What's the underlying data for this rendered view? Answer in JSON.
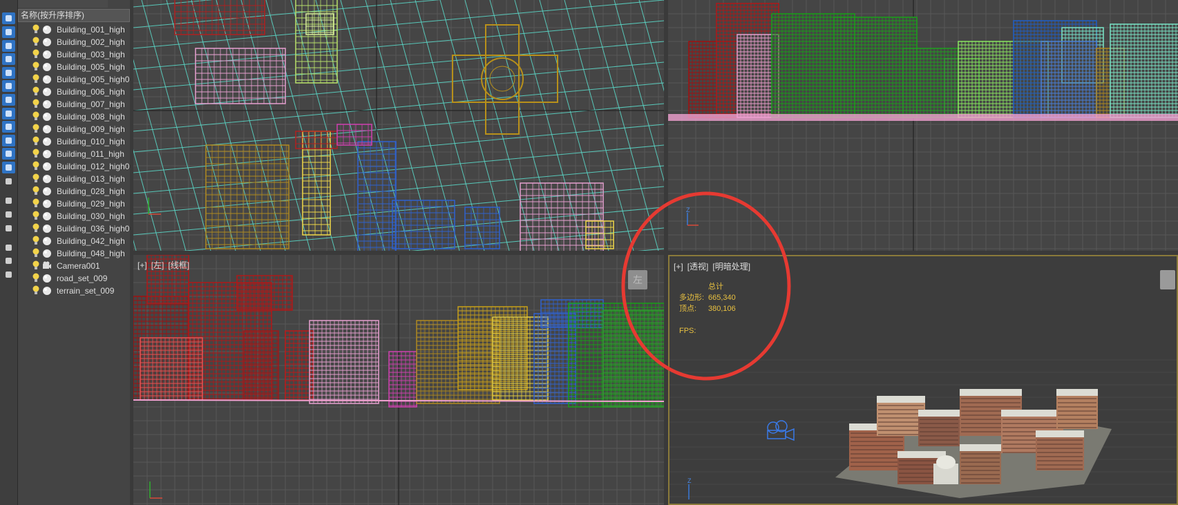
{
  "explorer": {
    "header": "名称(按升序排序)",
    "items": [
      {
        "label": "Building_001_high",
        "type": "geometry"
      },
      {
        "label": "Building_002_high",
        "type": "geometry"
      },
      {
        "label": "Building_003_high",
        "type": "geometry"
      },
      {
        "label": "Building_005_high",
        "type": "geometry"
      },
      {
        "label": "Building_005_high0",
        "type": "geometry"
      },
      {
        "label": "Building_006_high",
        "type": "geometry"
      },
      {
        "label": "Building_007_high",
        "type": "geometry"
      },
      {
        "label": "Building_008_high",
        "type": "geometry"
      },
      {
        "label": "Building_009_high",
        "type": "geometry"
      },
      {
        "label": "Building_010_high",
        "type": "geometry"
      },
      {
        "label": "Building_011_high",
        "type": "geometry"
      },
      {
        "label": "Building_012_high0",
        "type": "geometry"
      },
      {
        "label": "Building_013_high",
        "type": "geometry"
      },
      {
        "label": "Building_028_high",
        "type": "geometry"
      },
      {
        "label": "Building_029_high",
        "type": "geometry"
      },
      {
        "label": "Building_030_high",
        "type": "geometry"
      },
      {
        "label": "Building_036_high0",
        "type": "geometry"
      },
      {
        "label": "Building_042_high",
        "type": "geometry"
      },
      {
        "label": "Building_048_high",
        "type": "geometry"
      },
      {
        "label": "Camera001",
        "type": "camera"
      },
      {
        "label": "road_set_009",
        "type": "geometry"
      },
      {
        "label": "terrain_set_009",
        "type": "geometry"
      }
    ]
  },
  "viewports": {
    "left": {
      "label_plus": "[+]",
      "label_view": "[左]",
      "label_shading": "[线框]",
      "navcube": "左"
    },
    "perspective": {
      "label_plus": "[+]",
      "label_view": "[透视]",
      "label_shading": "[明暗处理]",
      "stats_title": "总计",
      "polygons_label": "多边形:",
      "polygons_value": "665,340",
      "vertices_label": "顶点:",
      "vertices_value": "380,106",
      "fps_label": "FPS:"
    },
    "axis_label": "Z"
  },
  "colors": {
    "grid": "#5a5a5a",
    "grid_major": "#2a2a2a",
    "annotation": "#e63a32",
    "stats": "#e8c040"
  },
  "toolstrip": {
    "icons": [
      "sphere-icon",
      "display-icon",
      "select-icon",
      "hierarchy-icon",
      "camera-filter-icon",
      "layers-icon",
      "wave-icon",
      "link-icon",
      "box-icon",
      "select-region-icon",
      "group-icon",
      "container-icon",
      "xref-icon",
      "list-icon",
      "document-icon",
      "document-icon",
      "filter-icon",
      "filter-settings-icon",
      "options-icon"
    ]
  }
}
